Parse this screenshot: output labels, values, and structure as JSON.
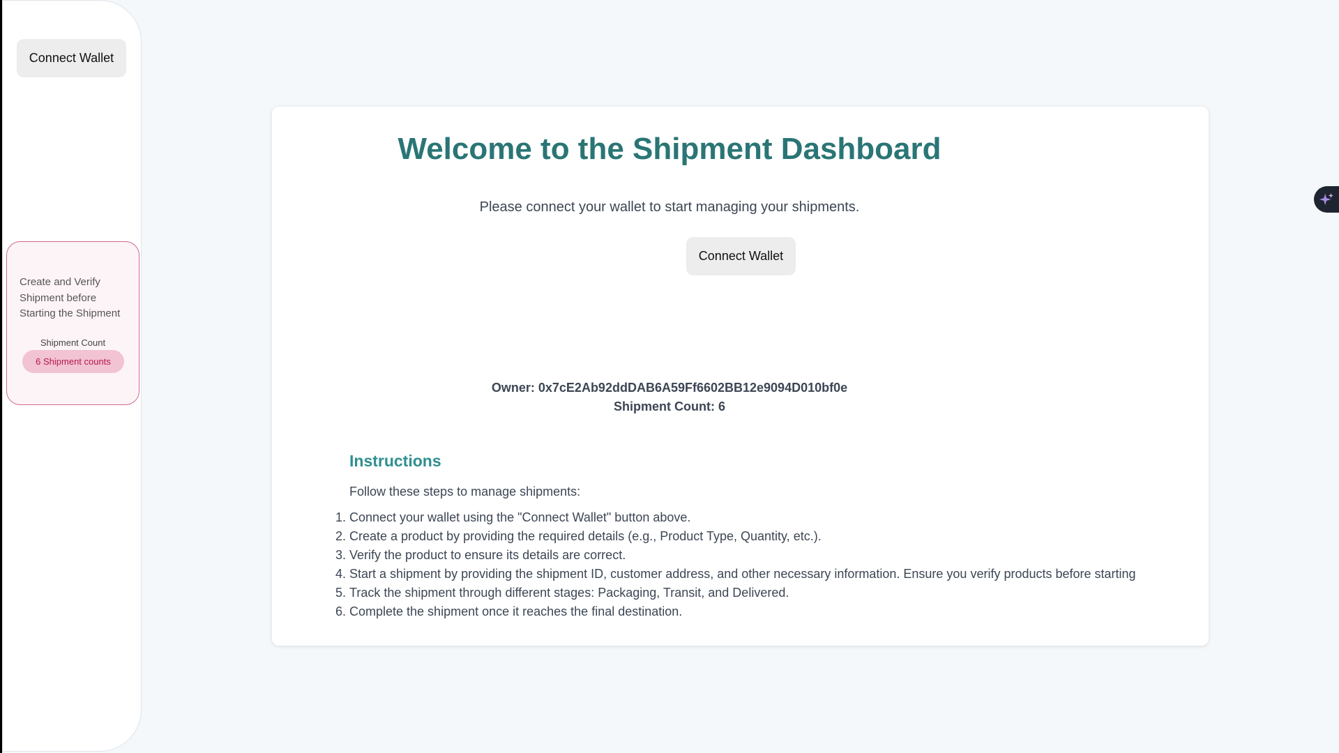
{
  "sidebar": {
    "connect_label": "Connect Wallet",
    "info": {
      "text": "Create and Verify Shipment before Starting the Shipment",
      "count_label": "Shipment Count",
      "count_badge": "6 Shipment counts"
    }
  },
  "main": {
    "title": "Welcome to the Shipment Dashboard",
    "subtitle": "Please connect your wallet to start managing your shipments.",
    "connect_label": "Connect Wallet",
    "owner": "Owner: 0x7cE2Ab92ddDAB6A59Ff6602BB12e9094D010bf0e",
    "shipment_count": "Shipment Count: 6",
    "instructions": {
      "title": "Instructions",
      "lead": "Follow these steps to manage shipments:",
      "steps": [
        "Connect your wallet using the \"Connect Wallet\" button above.",
        "Create a product by providing the required details (e.g., Product Type, Quantity, etc.).",
        "Verify the product to ensure its details are correct.",
        "Start a shipment by providing the shipment ID, customer address, and other necessary information. Ensure you verify products before starting",
        "Track the shipment through different stages: Packaging, Transit, and Delivered.",
        "Complete the shipment once it reaches the final destination."
      ]
    }
  },
  "assistant_tab": {
    "icon": "sparkle-icon"
  },
  "colors": {
    "title": "#2a7575",
    "instructions_title": "#2f8f8f",
    "badge_bg": "#f2c3d2",
    "badge_text": "#b5184c",
    "card_border": "#d06a8f",
    "button_bg": "#ededed",
    "page_bg": "#f5f8fb"
  }
}
